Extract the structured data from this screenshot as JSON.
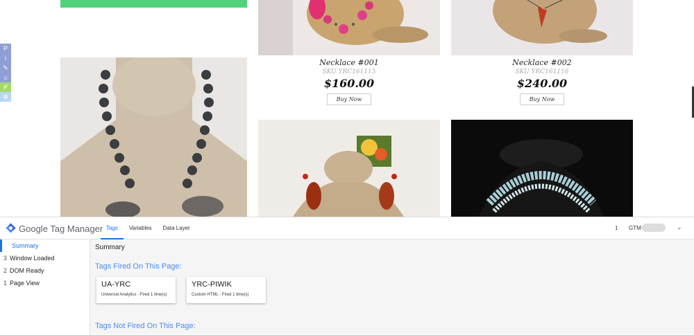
{
  "products": [
    {
      "name": "Necklace #001",
      "sku": "SKU YRC161115",
      "price": "$160.00",
      "buy_label": "Buy Now"
    },
    {
      "name": "Necklace #002",
      "sku": "SKU YRC161116",
      "price": "$240.00",
      "buy_label": "Buy Now"
    }
  ],
  "side_tools": [
    {
      "icon": "pinterest-icon",
      "glyph": "P",
      "color": "#8f9fd6"
    },
    {
      "icon": "info-icon",
      "glyph": "i",
      "color": "#8f9fd6"
    },
    {
      "icon": "pencil-icon",
      "glyph": "✎",
      "color": "#8f9fd6"
    },
    {
      "icon": "lock-icon",
      "glyph": "⌂",
      "color": "#8f9fd6"
    },
    {
      "icon": "pen-icon",
      "glyph": "✐",
      "color": "#a5d96b"
    },
    {
      "icon": "gear-icon",
      "glyph": "⚙",
      "color": "#b9d7f5"
    }
  ],
  "gtm": {
    "brand": "Google Tag Manager",
    "tabs": [
      "Tags",
      "Variables",
      "Data Layer"
    ],
    "container_count": "1",
    "container_id": "GTM-",
    "events": [
      {
        "num": "",
        "label": "Summary"
      },
      {
        "num": "3",
        "label": "Window Loaded"
      },
      {
        "num": "2",
        "label": "DOM Ready"
      },
      {
        "num": "1",
        "label": "Page View"
      }
    ],
    "summary_title": "Summary",
    "fired_title": "Tags Fired On This Page:",
    "not_fired_title": "Tags Not Fired On This Page:",
    "fired_tags": [
      {
        "name": "UA-YRC",
        "detail": "Universal Analytics - Fired 1 time(s)"
      },
      {
        "name": "YRC-PIWIK",
        "detail": "Custom HTML - Fired 1 time(s)"
      }
    ],
    "accent": "#1a73e8"
  }
}
